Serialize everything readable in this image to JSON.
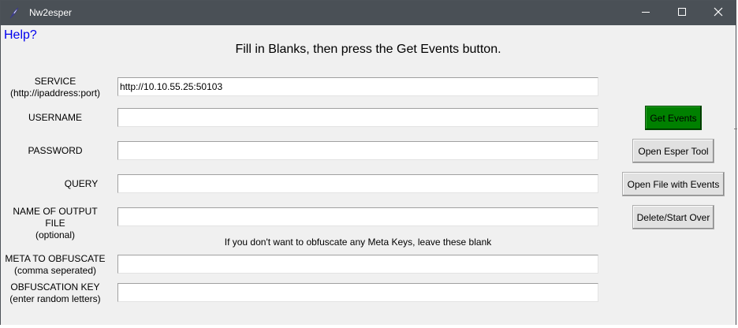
{
  "window": {
    "title": "Nw2esper"
  },
  "help_link": "Help?",
  "heading": "Fill in Blanks, then press the Get Events button.",
  "fields": {
    "service": {
      "label_line1": "SERVICE",
      "label_line2": "(http://ipaddress:port)",
      "value": "http://10.10.55.25:50103"
    },
    "username": {
      "label_line1": "USERNAME",
      "value": ""
    },
    "password": {
      "label_line1": "PASSWORD",
      "value": ""
    },
    "query": {
      "label_line1": "QUERY",
      "value": ""
    },
    "output_file": {
      "label_line1": "NAME OF OUTPUT FILE",
      "label_line2": "(optional)",
      "value": ""
    },
    "meta_obfuscate": {
      "label_line1": "META TO OBFUSCATE",
      "label_line2": "(comma seperated)",
      "value": ""
    },
    "obfuscation_key": {
      "label_line1": "OBFUSCATION KEY",
      "label_line2": "(enter random letters)",
      "value": ""
    }
  },
  "obfuscate_note": "If you don't want to obfuscate any Meta Keys, leave these blank",
  "buttons": {
    "get_events": "Get Events",
    "open_esper": "Open Esper Tool",
    "open_file": "Open File with Events",
    "delete_start_over": "Delete/Start Over"
  },
  "colors": {
    "titlebar": "#4a5056",
    "get_events_bg": "#008000",
    "help_link": "#0000ee",
    "window_bg": "#f0f0f0"
  },
  "icons": [
    "feather-icon",
    "minimize-icon",
    "maximize-icon",
    "close-icon"
  ]
}
